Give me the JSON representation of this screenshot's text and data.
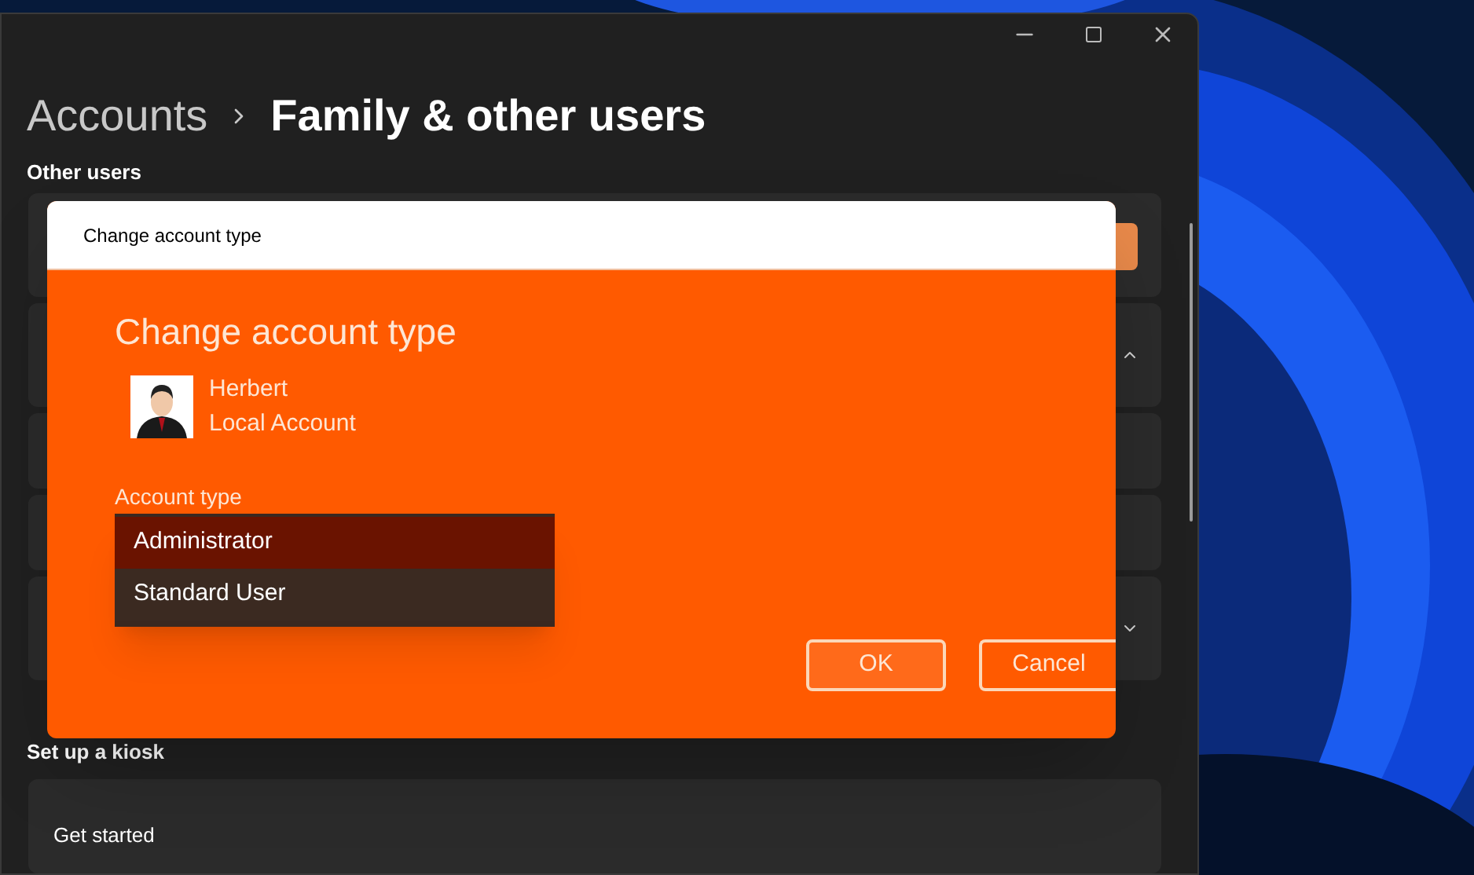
{
  "breadcrumb": [
    {
      "label": "Accounts"
    },
    {
      "label": "Family & other users"
    }
  ],
  "other_users": {
    "heading": "Other users",
    "cards": [
      {
        "kind": "button"
      },
      {
        "kind": "expander",
        "expanded": true
      },
      {
        "kind": "plain"
      },
      {
        "kind": "plain"
      },
      {
        "kind": "expander",
        "expanded": false
      }
    ]
  },
  "kiosk": {
    "heading": "Set up a kiosk",
    "card_label": "Get started"
  },
  "dialog": {
    "title": "Change account type",
    "heading": "Change account type",
    "user": {
      "name": "Herbert",
      "account": "Local Account"
    },
    "field_label": "Account type",
    "options": [
      {
        "label": "Administrator",
        "selected": true
      },
      {
        "label": "Standard User",
        "selected": false
      }
    ],
    "buttons": [
      {
        "label": "OK"
      },
      {
        "label": "Cancel"
      }
    ]
  }
}
